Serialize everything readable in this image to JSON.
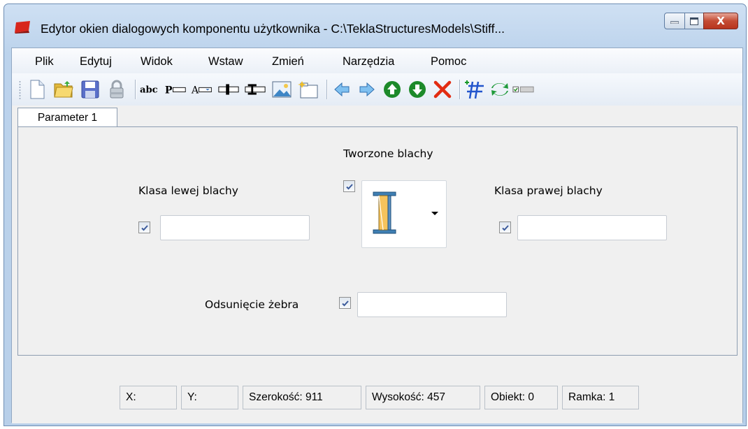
{
  "window": {
    "title": "Edytor okien dialogowych komponentu użytkownika - C:\\TeklaStructuresModels\\Stiff...",
    "controls": {
      "close": "X"
    }
  },
  "menu": [
    "Plik",
    "Edytuj",
    "Widok",
    "Wstaw",
    "Zmień",
    "Narzędzia",
    "Pomoc"
  ],
  "toolbar": {
    "icons": [
      "new-file-icon",
      "open-folder-icon",
      "save-icon",
      "lock-icon",
      "label-icon",
      "parameter-icon",
      "dropdown-field-icon",
      "attribute-icon",
      "i-profile-icon",
      "picture-icon",
      "tab-page-icon",
      "arrow-left-icon",
      "arrow-right-icon",
      "arrow-up-icon",
      "arrow-down-icon",
      "delete-icon",
      "grid-icon",
      "refresh-icon",
      "checkbox-toggle-icon"
    ],
    "text_icons": {
      "abc": "abc",
      "p": "P",
      "a": "A"
    }
  },
  "tabs": [
    {
      "label": "Parameter 1"
    }
  ],
  "form": {
    "plates_label": "Tworzone blachy",
    "left_class_label": "Klasa lewej blachy",
    "right_class_label": "Klasa prawej blachy",
    "offset_label": "Odsunięcie żebra",
    "left_class_value": "",
    "right_class_value": "",
    "offset_value": "",
    "left_checked": true,
    "plates_checked": true,
    "right_checked": true,
    "offset_checked": true
  },
  "status": {
    "x": "X:",
    "y": "Y:",
    "width": "Szerokość: 911",
    "height": "Wysokość: 457",
    "object": "Obiekt: 0",
    "frame": "Ramka: 1"
  },
  "colors": {
    "accent_check": "#3b5b9c",
    "plate_fill": "#f6c35c",
    "profile_blue": "#3f7fb3"
  }
}
